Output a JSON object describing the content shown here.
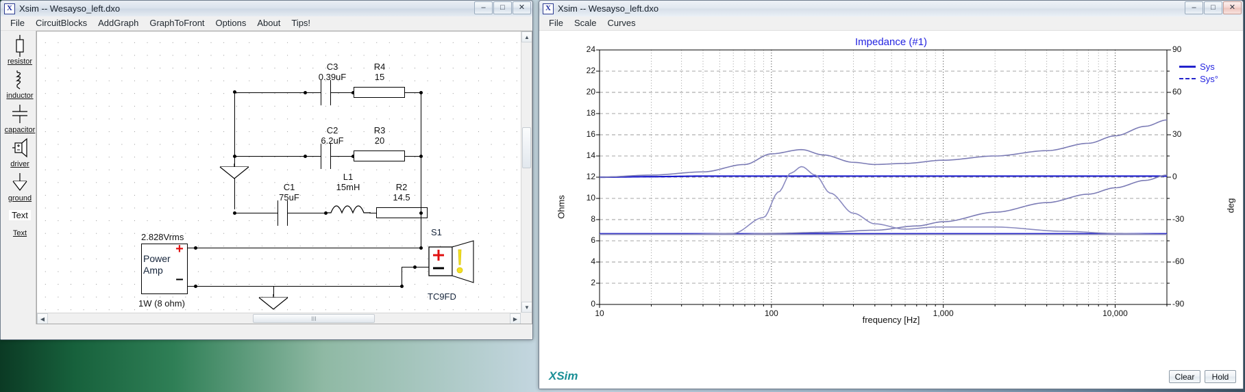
{
  "left_window": {
    "title": "Xsim -- Wesayso_left.dxo",
    "icon": "xsim-app-icon",
    "controls": {
      "minimize": "–",
      "maximize": "□",
      "close": "✕"
    },
    "menu": [
      "File",
      "CircuitBlocks",
      "AddGraph",
      "GraphToFront",
      "Options",
      "About",
      "Tips!"
    ],
    "toolbox": [
      {
        "name": "resistor",
        "label": "resistor",
        "icon": "resistor-icon"
      },
      {
        "name": "inductor",
        "label": "inductor",
        "icon": "inductor-icon"
      },
      {
        "name": "capacitor",
        "label": "capacitor",
        "icon": "capacitor-icon"
      },
      {
        "name": "driver",
        "label": "driver",
        "icon": "driver-icon"
      },
      {
        "name": "ground",
        "label": "ground",
        "icon": "ground-icon"
      },
      {
        "name": "text-box",
        "label": "Text",
        "icon": "text-box-icon"
      },
      {
        "name": "text-tool",
        "label": "Text",
        "icon": "text-tool-icon"
      }
    ],
    "schematic": {
      "components": [
        {
          "id": "C3",
          "value": "0.39uF",
          "type": "capacitor"
        },
        {
          "id": "R4",
          "value": "15",
          "type": "resistor"
        },
        {
          "id": "C2",
          "value": "6.2uF",
          "type": "capacitor"
        },
        {
          "id": "R3",
          "value": "20",
          "type": "resistor"
        },
        {
          "id": "C1",
          "value": "75uF",
          "type": "capacitor"
        },
        {
          "id": "L1",
          "value": "15mH",
          "type": "inductor"
        },
        {
          "id": "R2",
          "value": "14.5",
          "type": "resistor"
        },
        {
          "id": "S1",
          "value": "TC9FD",
          "type": "driver"
        }
      ],
      "source": {
        "voltage": "2.828Vrms",
        "line1": "Power",
        "line2": "Amp",
        "power": "1W (8 ohm)",
        "plus": "+",
        "minus": "–"
      }
    },
    "hscroll_thumb_glyph": "III"
  },
  "right_window": {
    "title": "Xsim -- Wesayso_left.dxo",
    "icon": "xsim-app-icon",
    "controls": {
      "minimize": "–",
      "maximize": "□",
      "close": "✕"
    },
    "menu": [
      "File",
      "Scale",
      "Curves"
    ],
    "buttons": {
      "clear": "Clear",
      "hold": "Hold"
    },
    "logo": "XSim"
  },
  "chart_data": {
    "type": "line",
    "title": "Impedance (#1)",
    "xlabel": "frequency [Hz]",
    "ylabel": "Ohms",
    "y2label": "deg",
    "xscale": "log",
    "xlim": [
      10,
      20000
    ],
    "ylim": [
      0,
      24
    ],
    "y2lim": [
      -90,
      90
    ],
    "grid": true,
    "legend_position": "top-right",
    "xticks_labeled": [
      "10",
      "100",
      "1,000",
      "10,000"
    ],
    "xtick_values": [
      10,
      100,
      1000,
      10000
    ],
    "yticks": [
      0,
      2,
      4,
      6,
      8,
      10,
      12,
      14,
      16,
      18,
      20,
      22,
      24
    ],
    "y2ticks": [
      -90,
      -60,
      -30,
      0,
      30,
      60,
      90
    ],
    "legend": [
      {
        "name": "Sys",
        "style": "solid",
        "color": "#2323cc"
      },
      {
        "name": "Sys°",
        "style": "dashed",
        "color": "#2323cc"
      }
    ],
    "series": [
      {
        "name": "Sys impedance (flat, blue)",
        "axis": "left",
        "color": "#1a1acc",
        "style": "solid",
        "x": [
          10,
          20,
          40,
          70,
          100,
          150,
          200,
          300,
          500,
          800,
          1000,
          2000,
          4000,
          7000,
          10000,
          20000
        ],
        "y": [
          12.0,
          12.05,
          12.1,
          12.1,
          12.1,
          12.1,
          12.1,
          12.1,
          12.1,
          12.1,
          12.1,
          12.1,
          12.1,
          12.1,
          12.1,
          12.1
        ]
      },
      {
        "name": "Sys phase (flat, blue, lower)",
        "axis": "right",
        "color": "#1a1acc",
        "style": "solid",
        "x": [
          10,
          20,
          40,
          70,
          100,
          200,
          400,
          800,
          1500,
          3000,
          6000,
          10000,
          20000
        ],
        "y": [
          -40,
          -40,
          -40,
          -40,
          -40,
          -40,
          -40,
          -40,
          -40,
          -40,
          -40,
          -40,
          -40
        ]
      },
      {
        "name": "Driver impedance (gray/violet, rising)",
        "axis": "left",
        "color": "#7b7bb5",
        "style": "solid",
        "x": [
          10,
          20,
          40,
          70,
          100,
          150,
          200,
          300,
          400,
          600,
          1000,
          2000,
          4000,
          7000,
          10000,
          15000,
          20000
        ],
        "y": [
          12.0,
          12.2,
          12.5,
          13.2,
          14.2,
          14.6,
          14.1,
          13.4,
          13.2,
          13.3,
          13.6,
          14.0,
          14.5,
          15.2,
          15.9,
          16.8,
          17.4
        ]
      },
      {
        "name": "Driver phase rising (gray/violet)",
        "axis": "left",
        "color": "#7b7bb5",
        "style": "solid",
        "x": [
          10,
          30,
          60,
          100,
          200,
          400,
          700,
          1000,
          2000,
          4000,
          7000,
          10000,
          15000,
          20000
        ],
        "y": [
          6.6,
          6.6,
          6.6,
          6.7,
          6.8,
          7.0,
          7.4,
          7.8,
          8.7,
          9.6,
          10.4,
          11.0,
          11.7,
          12.2
        ]
      },
      {
        "name": "Sys resonance peak (dashed violet)",
        "axis": "left",
        "color": "#8a8ac0",
        "style": "solid",
        "x": [
          10,
          30,
          60,
          90,
          110,
          130,
          150,
          180,
          220,
          300,
          400,
          600,
          900,
          2000,
          5000,
          10000,
          20000
        ],
        "y": [
          6.6,
          6.6,
          6.7,
          8.2,
          10.6,
          12.4,
          13.0,
          12.2,
          10.5,
          8.6,
          7.6,
          7.1,
          7.3,
          7.3,
          6.9,
          6.7,
          6.6
        ]
      },
      {
        "name": "Flat gray baseline",
        "axis": "left",
        "color": "#8a8ab8",
        "style": "solid",
        "x": [
          10,
          100,
          1000,
          10000,
          20000
        ],
        "y": [
          6.6,
          6.6,
          6.6,
          6.6,
          6.6
        ]
      }
    ]
  }
}
